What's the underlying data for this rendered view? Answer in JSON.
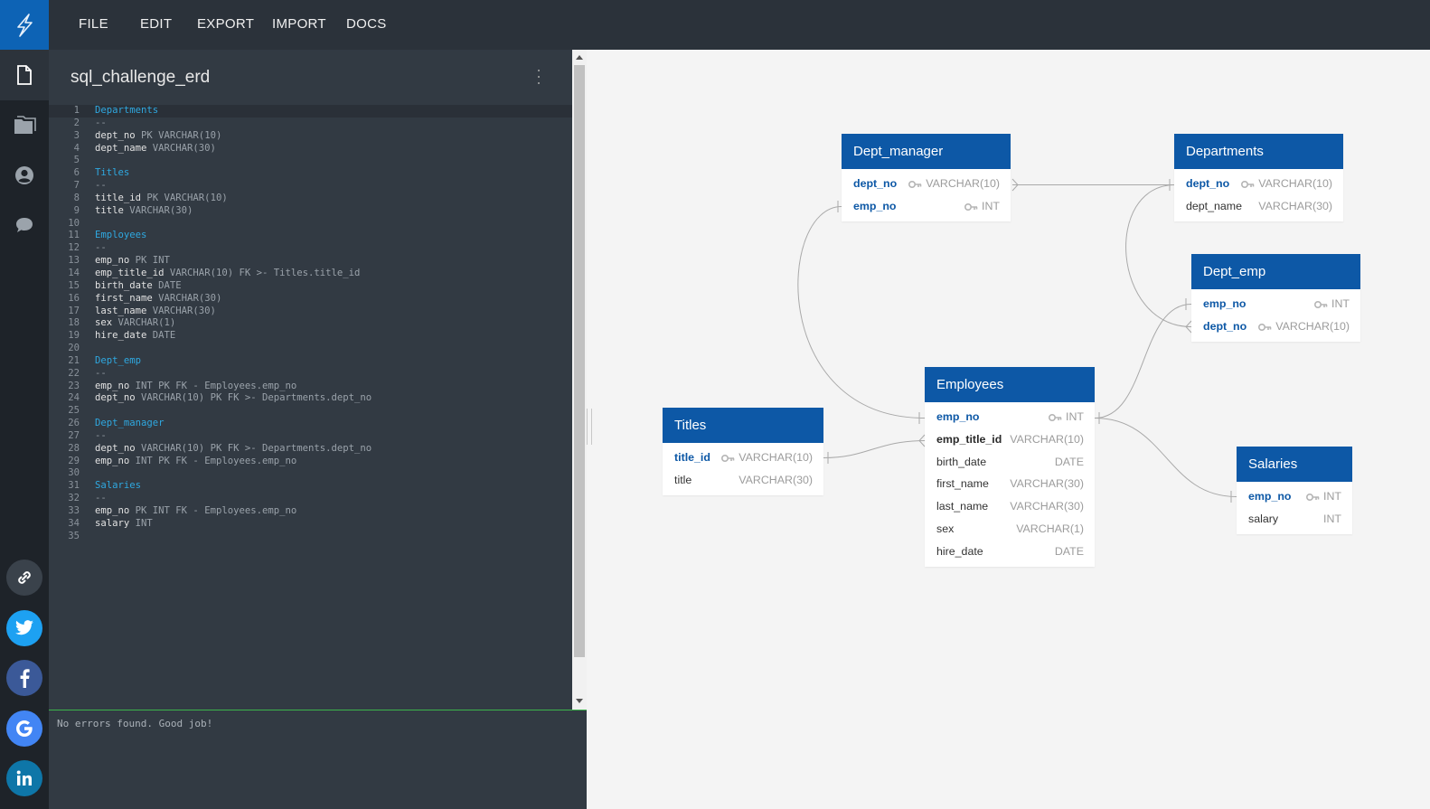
{
  "menu": [
    "FILE",
    "EDIT",
    "EXPORT",
    "IMPORT",
    "DOCS"
  ],
  "rail": {
    "icons": [
      "logo-icon",
      "document-icon",
      "folder-icon",
      "account-icon",
      "chat-icon"
    ],
    "social": [
      "link",
      "twitter",
      "facebook",
      "google",
      "linkedin"
    ]
  },
  "editor": {
    "title": "sql_challenge_erd",
    "lines": [
      {
        "n": "1",
        "parts": [
          [
            "t-table",
            "Departments"
          ]
        ]
      },
      {
        "n": "2",
        "parts": [
          [
            "t-sep",
            "--"
          ]
        ]
      },
      {
        "n": "3",
        "parts": [
          [
            "t-col",
            "dept_no "
          ],
          [
            "t-rest",
            "PK VARCHAR(10)"
          ]
        ]
      },
      {
        "n": "4",
        "parts": [
          [
            "t-col",
            "dept_name "
          ],
          [
            "t-rest",
            "VARCHAR(30)"
          ]
        ]
      },
      {
        "n": "5",
        "parts": []
      },
      {
        "n": "6",
        "parts": [
          [
            "t-table",
            "Titles"
          ]
        ]
      },
      {
        "n": "7",
        "parts": [
          [
            "t-sep",
            "--"
          ]
        ]
      },
      {
        "n": "8",
        "parts": [
          [
            "t-col",
            "title_id "
          ],
          [
            "t-rest",
            "PK VARCHAR(10)"
          ]
        ]
      },
      {
        "n": "9",
        "parts": [
          [
            "t-col",
            "title "
          ],
          [
            "t-rest",
            "VARCHAR(30)"
          ]
        ]
      },
      {
        "n": "10",
        "parts": []
      },
      {
        "n": "11",
        "parts": [
          [
            "t-table",
            "Employees"
          ]
        ]
      },
      {
        "n": "12",
        "parts": [
          [
            "t-sep",
            "--"
          ]
        ]
      },
      {
        "n": "13",
        "parts": [
          [
            "t-col",
            "emp_no "
          ],
          [
            "t-rest",
            "PK INT"
          ]
        ]
      },
      {
        "n": "14",
        "parts": [
          [
            "t-col",
            "emp_title_id "
          ],
          [
            "t-rest",
            "VARCHAR(10) FK >- Titles.title_id"
          ]
        ]
      },
      {
        "n": "15",
        "parts": [
          [
            "t-col",
            "birth_date "
          ],
          [
            "t-rest",
            "DATE"
          ]
        ]
      },
      {
        "n": "16",
        "parts": [
          [
            "t-col",
            "first_name "
          ],
          [
            "t-rest",
            "VARCHAR(30)"
          ]
        ]
      },
      {
        "n": "17",
        "parts": [
          [
            "t-col",
            "last_name "
          ],
          [
            "t-rest",
            "VARCHAR(30)"
          ]
        ]
      },
      {
        "n": "18",
        "parts": [
          [
            "t-col",
            "sex "
          ],
          [
            "t-rest",
            "VARCHAR(1)"
          ]
        ]
      },
      {
        "n": "19",
        "parts": [
          [
            "t-col",
            "hire_date "
          ],
          [
            "t-rest",
            "DATE"
          ]
        ]
      },
      {
        "n": "20",
        "parts": []
      },
      {
        "n": "21",
        "parts": [
          [
            "t-table",
            "Dept_emp"
          ]
        ]
      },
      {
        "n": "22",
        "parts": [
          [
            "t-sep",
            "--"
          ]
        ]
      },
      {
        "n": "23",
        "parts": [
          [
            "t-col",
            "emp_no "
          ],
          [
            "t-rest",
            "INT PK FK - Employees.emp_no"
          ]
        ]
      },
      {
        "n": "24",
        "parts": [
          [
            "t-col",
            "dept_no "
          ],
          [
            "t-rest",
            "VARCHAR(10) PK FK >- Departments.dept_no"
          ]
        ]
      },
      {
        "n": "25",
        "parts": []
      },
      {
        "n": "26",
        "parts": [
          [
            "t-table",
            "Dept_manager"
          ]
        ]
      },
      {
        "n": "27",
        "parts": [
          [
            "t-sep",
            "--"
          ]
        ]
      },
      {
        "n": "28",
        "parts": [
          [
            "t-col",
            "dept_no "
          ],
          [
            "t-rest",
            "VARCHAR(10) PK FK >- Departments.dept_no"
          ]
        ]
      },
      {
        "n": "29",
        "parts": [
          [
            "t-col",
            "emp_no "
          ],
          [
            "t-rest",
            "INT PK FK - Employees.emp_no"
          ]
        ]
      },
      {
        "n": "30",
        "parts": []
      },
      {
        "n": "31",
        "parts": [
          [
            "t-table",
            "Salaries"
          ]
        ]
      },
      {
        "n": "32",
        "parts": [
          [
            "t-sep",
            "--"
          ]
        ]
      },
      {
        "n": "33",
        "parts": [
          [
            "t-col",
            "emp_no "
          ],
          [
            "t-rest",
            "PK INT FK - Employees.emp_no"
          ]
        ]
      },
      {
        "n": "34",
        "parts": [
          [
            "t-col",
            "salary "
          ],
          [
            "t-rest",
            "INT"
          ]
        ]
      },
      {
        "n": "35",
        "parts": []
      }
    ]
  },
  "status": "No errors found. Good job!",
  "diagram": {
    "tables": [
      {
        "id": "dept_manager",
        "name": "Dept_manager",
        "rows": [
          {
            "col": "dept_no",
            "type": "VARCHAR(10)",
            "key": true,
            "style": "key"
          },
          {
            "col": "emp_no",
            "type": "INT",
            "key": true,
            "style": "key"
          }
        ]
      },
      {
        "id": "departments",
        "name": "Departments",
        "rows": [
          {
            "col": "dept_no",
            "type": "VARCHAR(10)",
            "key": true,
            "style": "key"
          },
          {
            "col": "dept_name",
            "type": "VARCHAR(30)",
            "key": false,
            "style": "plain"
          }
        ]
      },
      {
        "id": "dept_emp",
        "name": "Dept_emp",
        "rows": [
          {
            "col": "emp_no",
            "type": "INT",
            "key": true,
            "style": "key"
          },
          {
            "col": "dept_no",
            "type": "VARCHAR(10)",
            "key": true,
            "style": "key"
          }
        ]
      },
      {
        "id": "titles",
        "name": "Titles",
        "rows": [
          {
            "col": "title_id",
            "type": "VARCHAR(10)",
            "key": true,
            "style": "key"
          },
          {
            "col": "title",
            "type": "VARCHAR(30)",
            "key": false,
            "style": "plain"
          }
        ]
      },
      {
        "id": "employees",
        "name": "Employees",
        "rows": [
          {
            "col": "emp_no",
            "type": "INT",
            "key": true,
            "style": "key"
          },
          {
            "col": "emp_title_id",
            "type": "VARCHAR(10)",
            "key": false,
            "style": "fk"
          },
          {
            "col": "birth_date",
            "type": "DATE",
            "key": false,
            "style": "plain"
          },
          {
            "col": "first_name",
            "type": "VARCHAR(30)",
            "key": false,
            "style": "plain"
          },
          {
            "col": "last_name",
            "type": "VARCHAR(30)",
            "key": false,
            "style": "plain"
          },
          {
            "col": "sex",
            "type": "VARCHAR(1)",
            "key": false,
            "style": "plain"
          },
          {
            "col": "hire_date",
            "type": "DATE",
            "key": false,
            "style": "plain"
          }
        ]
      },
      {
        "id": "salaries",
        "name": "Salaries",
        "rows": [
          {
            "col": "emp_no",
            "type": "INT",
            "key": true,
            "style": "key"
          },
          {
            "col": "salary",
            "type": "INT",
            "key": false,
            "style": "plain"
          }
        ]
      }
    ]
  },
  "colors": {
    "accent": "#0d58a6",
    "rail": "#1e2329",
    "editor": "#323a43",
    "keyword": "#2fa8e0"
  }
}
